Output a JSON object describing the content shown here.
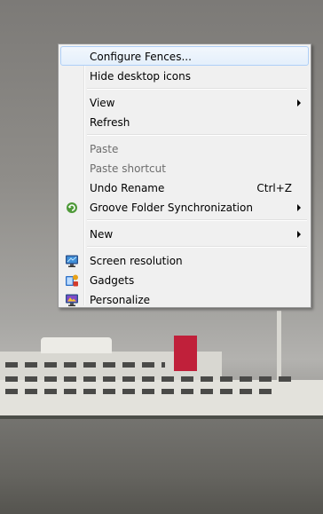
{
  "context_menu": {
    "items": [
      {
        "label": "Configure Fences..."
      },
      {
        "label": "Hide desktop icons"
      },
      {
        "label": "View"
      },
      {
        "label": "Refresh"
      },
      {
        "label": "Paste"
      },
      {
        "label": "Paste shortcut"
      },
      {
        "label": "Undo Rename",
        "shortcut": "Ctrl+Z"
      },
      {
        "label": "Groove Folder Synchronization"
      },
      {
        "label": "New"
      },
      {
        "label": "Screen resolution"
      },
      {
        "label": "Gadgets"
      },
      {
        "label": "Personalize"
      }
    ]
  },
  "icons": {
    "groove": "groove-icon",
    "screen_resolution": "monitor-icon",
    "gadgets": "gadgets-icon",
    "personalize": "personalize-icon"
  },
  "colors": {
    "highlight_border": "#aecff7",
    "highlight_fill": "#e4effb",
    "disabled_text": "#6d6d6d",
    "menu_background": "#f0f0f0"
  }
}
